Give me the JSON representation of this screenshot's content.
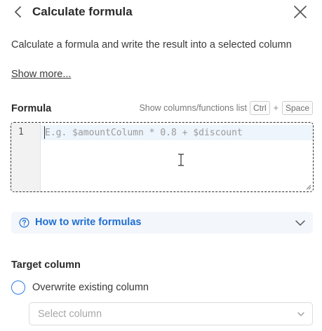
{
  "header": {
    "title": "Calculate formula",
    "back_icon": "chevron-left-icon",
    "close_icon": "close-icon"
  },
  "description": "Calculate a formula and write the result into a selected column",
  "show_more_label": "Show more...",
  "formula": {
    "label": "Formula",
    "hint_text": "Show columns/functions list",
    "hint_key1": "Ctrl",
    "hint_plus": "+",
    "hint_key2": "Space",
    "line_number": "1",
    "placeholder": "E.g. $amountColumn * 0.8 + $discount"
  },
  "help": {
    "label": "How to write formulas",
    "icon": "question-circle-icon",
    "expand_icon": "chevron-down-icon"
  },
  "target": {
    "label": "Target column",
    "radio_label": "Overwrite existing column",
    "select_placeholder": "Select column"
  },
  "colors": {
    "accent": "#1f6fd1",
    "radio_border": "#2b7de9",
    "help_bg": "#f3f6fb"
  }
}
